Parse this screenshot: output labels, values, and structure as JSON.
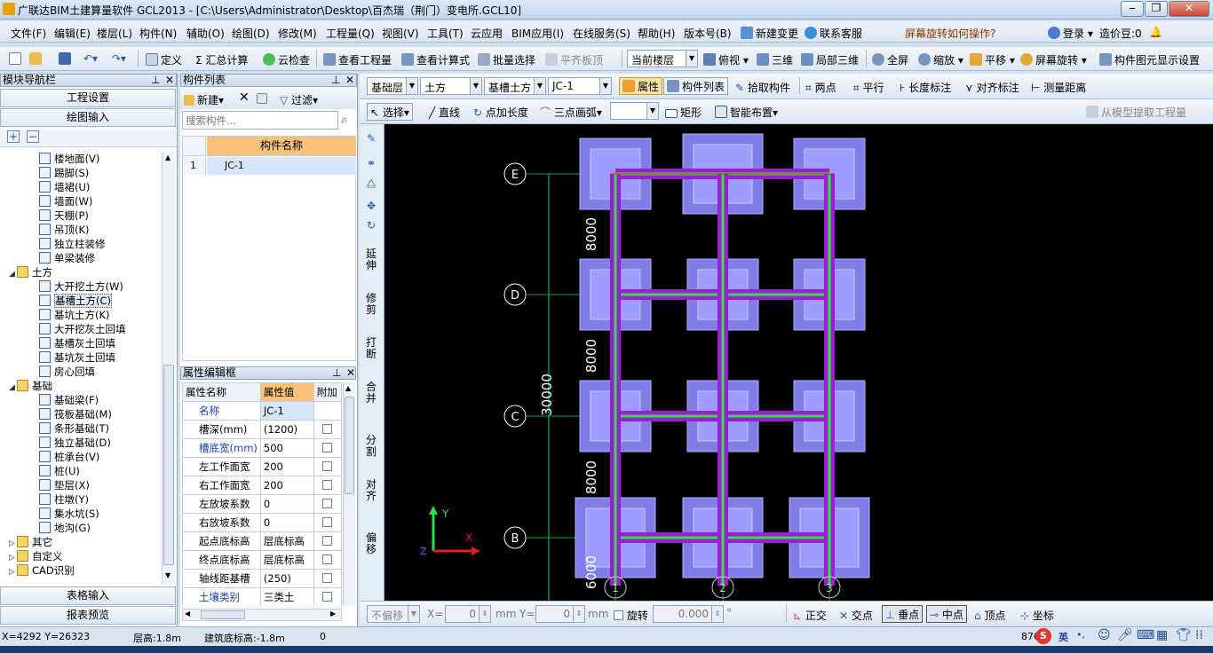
{
  "window": {
    "title": "广联达BIM土建算量软件 GCL2013 - [C:\\Users\\Administrator\\Desktop\\百杰瑞（荆门）变电所.GCL10]"
  },
  "menu": [
    "文件(F)",
    "编辑(E)",
    "楼层(L)",
    "构件(N)",
    "辅助(O)",
    "绘图(D)",
    "修改(M)",
    "工程量(Q)",
    "视图(V)",
    "工具(T)",
    "云应用",
    "BIM应用(I)",
    "在线服务(S)",
    "帮助(H)",
    "版本号(B)",
    "新建变更",
    "联系客服",
    "屏幕旋转如何操作?",
    "登录",
    "造价豆:0"
  ],
  "toolbar1": {
    "define": "定义",
    "sum": "汇总计算",
    "cloudcheck": "云检查",
    "viewqty": "查看工程量",
    "viewformula": "查看计算式",
    "batchselect": "批量选择",
    "flatboard": "平齐板顶",
    "floorcombo": "当前楼层",
    "view": "俯视",
    "threed": "三维",
    "local3d": "局部三维",
    "fullscreen": "全屏",
    "zoom": "缩放",
    "pan": "平移",
    "rotate": "屏幕旋转",
    "display": "构件图元显示设置"
  },
  "leftpanel": {
    "title": "模块导航栏",
    "project_settings": "工程设置",
    "draw_input": "绘图输入",
    "table_input": "表格输入",
    "report_preview": "报表预览",
    "tree": [
      {
        "label": "楼地面(V)",
        "level": 2
      },
      {
        "label": "踢脚(S)",
        "level": 2
      },
      {
        "label": "墙裙(U)",
        "level": 2
      },
      {
        "label": "墙面(W)",
        "level": 2
      },
      {
        "label": "天棚(P)",
        "level": 2
      },
      {
        "label": "吊顶(K)",
        "level": 2
      },
      {
        "label": "独立柱装修",
        "level": 2
      },
      {
        "label": "单梁装修",
        "level": 2
      },
      {
        "label": "土方",
        "level": 1,
        "folder": true,
        "open": true
      },
      {
        "label": "大开挖土方(W)",
        "level": 2
      },
      {
        "label": "基槽土方(C)",
        "level": 2,
        "selected": true
      },
      {
        "label": "基坑土方(K)",
        "level": 2
      },
      {
        "label": "大开挖灰土回填",
        "level": 2
      },
      {
        "label": "基槽灰土回填",
        "level": 2
      },
      {
        "label": "基坑灰土回填",
        "level": 2
      },
      {
        "label": "房心回填",
        "level": 2
      },
      {
        "label": "基础",
        "level": 1,
        "folder": true,
        "open": true
      },
      {
        "label": "基础梁(F)",
        "level": 2
      },
      {
        "label": "筏板基础(M)",
        "level": 2
      },
      {
        "label": "条形基础(T)",
        "level": 2
      },
      {
        "label": "独立基础(D)",
        "level": 2
      },
      {
        "label": "桩承台(V)",
        "level": 2
      },
      {
        "label": "桩(U)",
        "level": 2
      },
      {
        "label": "垫层(X)",
        "level": 2
      },
      {
        "label": "柱墩(Y)",
        "level": 2
      },
      {
        "label": "集水坑(S)",
        "level": 2
      },
      {
        "label": "地沟(G)",
        "level": 2
      },
      {
        "label": "其它",
        "level": 1,
        "folder": true
      },
      {
        "label": "自定义",
        "level": 1,
        "folder": true
      },
      {
        "label": "CAD识别",
        "level": 1,
        "folder": true
      }
    ]
  },
  "complist": {
    "title": "构件列表",
    "new": "新建",
    "filter": "过滤",
    "search_placeholder": "搜索构件...",
    "col_header": "构件名称",
    "rows": [
      {
        "no": "1",
        "name": "JC-1"
      }
    ]
  },
  "propedit": {
    "title": "属性编辑框",
    "headers": [
      "属性名称",
      "属性值",
      "附加"
    ],
    "rows": [
      {
        "name": "名称",
        "value": "JC-1",
        "blue": true
      },
      {
        "name": "槽深(mm)",
        "value": "(1200)"
      },
      {
        "name": "槽底宽(mm)",
        "value": "500",
        "blue": true
      },
      {
        "name": "左工作面宽",
        "value": "200"
      },
      {
        "name": "右工作面宽",
        "value": "200"
      },
      {
        "name": "左放坡系数",
        "value": "0"
      },
      {
        "name": "右放坡系数",
        "value": "0"
      },
      {
        "name": "起点底标高",
        "value": "层底标高"
      },
      {
        "name": "终点底标高",
        "value": "层底标高"
      },
      {
        "name": "轴线距基槽",
        "value": "(250)"
      },
      {
        "name": "土壤类别",
        "value": "三类土",
        "blue": true
      }
    ]
  },
  "drawtop": {
    "floor": "基础层",
    "type": "土方",
    "subtype": "基槽土方",
    "comp": "JC-1",
    "attr": "属性",
    "complist": "构件列表",
    "pick": "拾取构件",
    "twopoint": "两点",
    "parallel": "平行",
    "lendim": "长度标注",
    "aligndim": "对齐标注",
    "measure": "测量距离"
  },
  "drawbar": {
    "select": "选择",
    "line": "直线",
    "ptlen": "点加长度",
    "arc": "三点画弧",
    "rect": "矩形",
    "smart": "智能布置",
    "extract": "从模型提取工程量"
  },
  "vtools": [
    "延伸",
    "修剪",
    "打断",
    "合并",
    "分割",
    "对齐",
    "偏移"
  ],
  "canvas": {
    "axes_y": [
      {
        "label": "E"
      },
      {
        "label": "D"
      },
      {
        "label": "C"
      },
      {
        "label": "B"
      }
    ],
    "axes_x": [
      {
        "label": "1"
      },
      {
        "label": "2"
      },
      {
        "label": "3"
      }
    ],
    "dims": [
      "8000",
      "8000",
      "8000",
      "6000"
    ],
    "total": "30000",
    "ucs": {
      "x": "X",
      "y": "Y",
      "z": "Z"
    }
  },
  "bottombar": {
    "nooffset": "不偏移",
    "x_label": "X=",
    "x_val": "0",
    "y_label": "Y=",
    "y_val": "0",
    "unit": "mm",
    "rotate": "旋转",
    "rot_val": "0.000",
    "ortho": "正交",
    "intersect": "交点",
    "perp": "垂点",
    "mid": "中点",
    "vertex": "顶点",
    "coord": "坐标"
  },
  "status": {
    "coords": "X=4292  Y=26323",
    "floor_height": "层高:1.8m",
    "base_elev": "建筑底标高:-1.8m",
    "zero": "0",
    "right": "870"
  }
}
